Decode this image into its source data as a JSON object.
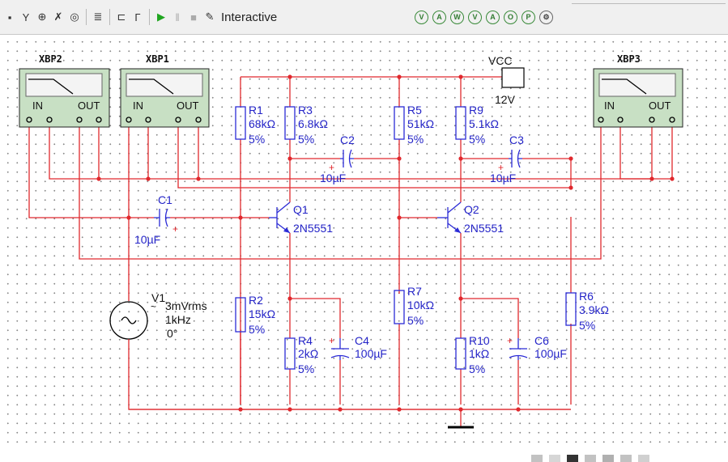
{
  "toolbar": {
    "sim_mode_label": "Interactive",
    "tools": [
      "multimeter-icon",
      "function-generator-icon",
      "wattmeter-icon",
      "oscilloscope-icon",
      "bode-plotter-icon",
      "probe-icon",
      "ground-icon",
      "connector-icon"
    ],
    "sim_buttons": [
      "run-icon",
      "pause-icon",
      "stop-icon"
    ],
    "probe_buttons": [
      "V",
      "A",
      "W",
      "V",
      "A",
      "O",
      "P",
      "gear"
    ]
  },
  "instruments": {
    "xbp2": {
      "title": "XBP2",
      "in_label": "IN",
      "out_label": "OUT"
    },
    "xbp1": {
      "title": "XBP1",
      "in_label": "IN",
      "out_label": "OUT"
    },
    "xbp3": {
      "title": "XBP3",
      "in_label": "IN",
      "out_label": "OUT"
    }
  },
  "supply": {
    "name": "VCC",
    "value": "12V"
  },
  "components": {
    "r1": {
      "name": "R1",
      "value": "68kΩ",
      "tol": "5%"
    },
    "r2": {
      "name": "R2",
      "value": "15kΩ",
      "tol": "5%"
    },
    "r3": {
      "name": "R3",
      "value": "6.8kΩ",
      "tol": "5%"
    },
    "r4": {
      "name": "R4",
      "value": "2kΩ",
      "tol": "5%"
    },
    "r5": {
      "name": "R5",
      "value": "51kΩ",
      "tol": "5%"
    },
    "r6": {
      "name": "R6",
      "value": "3.9kΩ",
      "tol": "5%"
    },
    "r7": {
      "name": "R7",
      "value": "10kΩ",
      "tol": "5%"
    },
    "r9": {
      "name": "R9",
      "value": "5.1kΩ",
      "tol": "5%"
    },
    "r10": {
      "name": "R10",
      "value": "1kΩ",
      "tol": "5%"
    },
    "c1": {
      "name": "C1",
      "value": "10µF"
    },
    "c2": {
      "name": "C2",
      "value": "10µF"
    },
    "c3": {
      "name": "C3",
      "value": "10µF"
    },
    "c4": {
      "name": "C4",
      "value": "100µF"
    },
    "c6": {
      "name": "C6",
      "value": "100µF"
    },
    "q1": {
      "name": "Q1",
      "part": "2N5551"
    },
    "q2": {
      "name": "Q2",
      "part": "2N5551"
    },
    "v1": {
      "name": "V1",
      "amp": "3mVrms",
      "freq": "1kHz",
      "phase": "0°"
    }
  },
  "colors": {
    "wire": "#e0282d",
    "component": "#2b2bd6",
    "instrument": "#c8e0c4"
  }
}
